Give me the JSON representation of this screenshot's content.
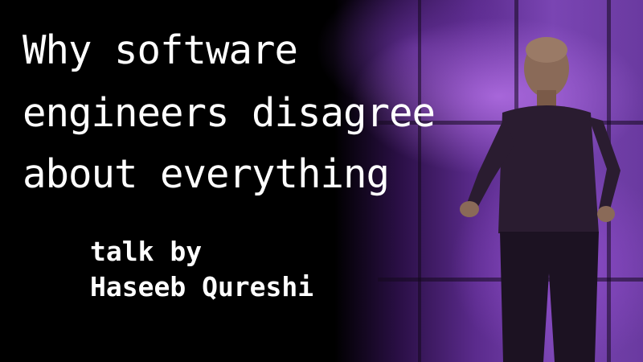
{
  "title": {
    "line1": "Why software",
    "line2": "engineers disagree",
    "line3": "about everything"
  },
  "subtitle": {
    "line1": "talk by",
    "line2": "Haseeb Qureshi"
  },
  "colors": {
    "background": "#000000",
    "text": "#ffffff",
    "stage_light": "#7a45b3"
  }
}
